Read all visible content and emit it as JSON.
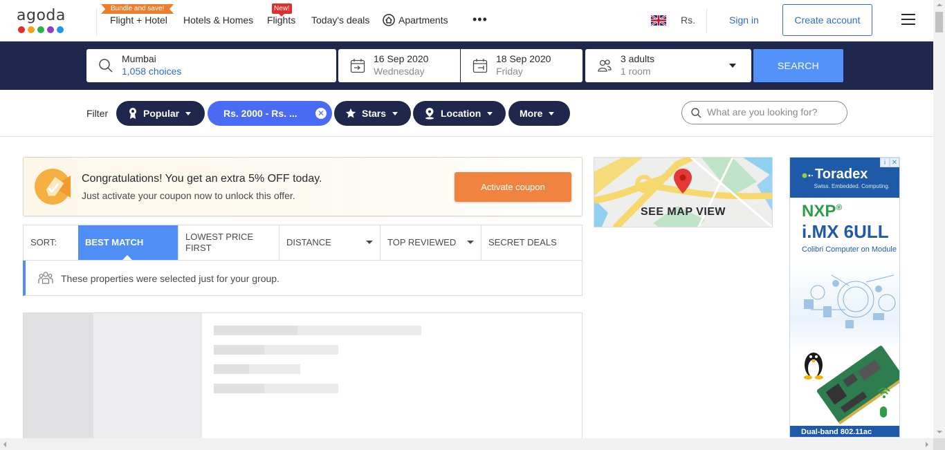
{
  "brand": {
    "logo_text": "agoda",
    "dot_colors": [
      "#e02d2d",
      "#f7a21b",
      "#2bb14c",
      "#8e3fbc",
      "#2196e8"
    ]
  },
  "nav": {
    "bundle_badge": "Bundle and save!",
    "flight_hotel": "Flight + Hotel",
    "hotels_homes": "Hotels & Homes",
    "new_badge": "New!",
    "flights": "Flights",
    "todays_deals": "Today's deals",
    "apartments": "Apartments",
    "more": "•••",
    "currency": "Rs.",
    "sign_in": "Sign in",
    "create_account": "Create account"
  },
  "search": {
    "destination": "Mumbai",
    "destination_sub": "1,058 choices",
    "checkin_date": "16 Sep 2020",
    "checkin_day": "Wednesday",
    "checkout_date": "18 Sep 2020",
    "checkout_day": "Friday",
    "guests": "3 adults",
    "rooms": "1 room",
    "button": "SEARCH"
  },
  "filters": {
    "label": "Filter",
    "popular": "Popular",
    "price": "Rs. 2000 - Rs. ...",
    "stars": "Stars",
    "location": "Location",
    "more": "More",
    "find_placeholder": "What are you looking for?"
  },
  "coupon": {
    "title": "Congratulations! You get an extra 5% OFF today.",
    "subtitle": "Just activate your coupon now to unlock this offer.",
    "button": "Activate coupon"
  },
  "map": {
    "label": "SEE MAP VIEW"
  },
  "sort": {
    "label": "SORT:",
    "options": [
      {
        "label": "BEST MATCH",
        "active": true
      },
      {
        "label": "LOWEST PRICE FIRST",
        "active": false
      },
      {
        "label": "DISTANCE",
        "active": false
      },
      {
        "label": "TOP REVIEWED",
        "active": false
      },
      {
        "label": "SECRET DEALS",
        "active": false
      }
    ]
  },
  "group_note": "These properties were selected just for your group.",
  "ad": {
    "brand": "Toradex",
    "tagline": "Swiss. Embedded. Computing.",
    "nxp": "NXP",
    "product": "i.MX 6ULL",
    "subtitle": "Colibri Computer on Module",
    "footer": "Dual-band 802.11ac"
  }
}
